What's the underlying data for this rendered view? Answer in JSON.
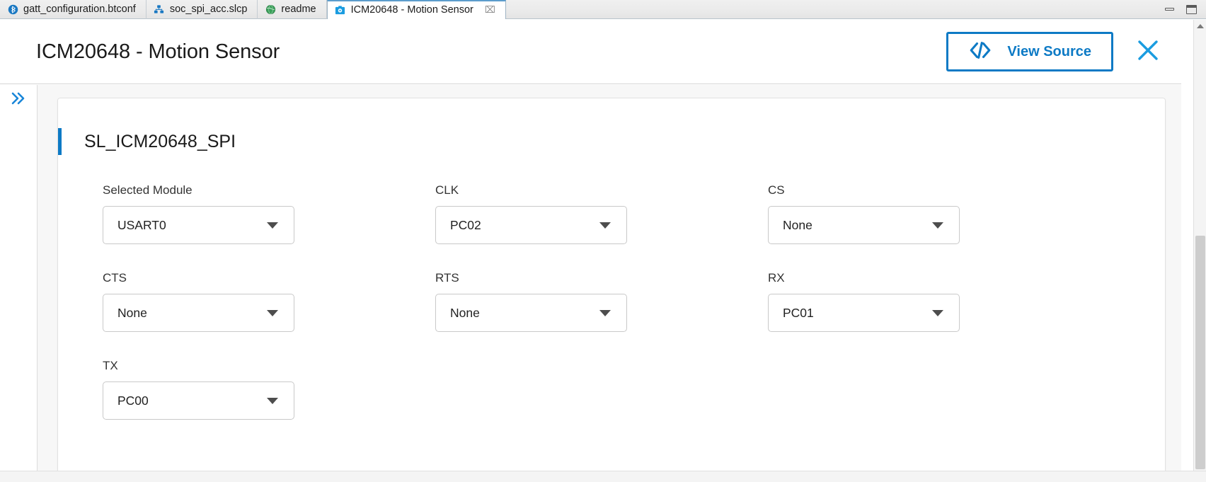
{
  "window": {
    "minimize_label": "Minimize",
    "maximize_label": "Restore",
    "accent_color": "#0d7ac5"
  },
  "tabs": [
    {
      "label": "gatt_configuration.btconf",
      "icon": "bluetooth-icon",
      "active": false,
      "closable": false
    },
    {
      "label": "soc_spi_acc.slcp",
      "icon": "project-blocks-icon",
      "active": false,
      "closable": false
    },
    {
      "label": "readme",
      "icon": "globe-icon",
      "active": false,
      "closable": false
    },
    {
      "label": "ICM20648 - Motion Sensor",
      "icon": "component-gear-icon",
      "active": true,
      "closable": true,
      "close_glyph": "⌧"
    }
  ],
  "header": {
    "title": "ICM20648 - Motion Sensor",
    "view_source_label": "View Source",
    "view_source_icon": "code-brackets-icon",
    "close_icon": "close-icon"
  },
  "sidebar": {
    "expand_icon": "chevron-double-right-icon",
    "expand_glyph": "»"
  },
  "card": {
    "title": "SL_ICM20648_SPI",
    "fields": [
      {
        "label": "Selected Module",
        "value": "USART0",
        "name": "selected-module"
      },
      {
        "label": "CLK",
        "value": "PC02",
        "name": "clk"
      },
      {
        "label": "CS",
        "value": "None",
        "name": "cs"
      },
      {
        "label": "CTS",
        "value": "None",
        "name": "cts"
      },
      {
        "label": "RTS",
        "value": "None",
        "name": "rts"
      },
      {
        "label": "RX",
        "value": "PC01",
        "name": "rx"
      },
      {
        "label": "TX",
        "value": "PC00",
        "name": "tx"
      }
    ]
  }
}
